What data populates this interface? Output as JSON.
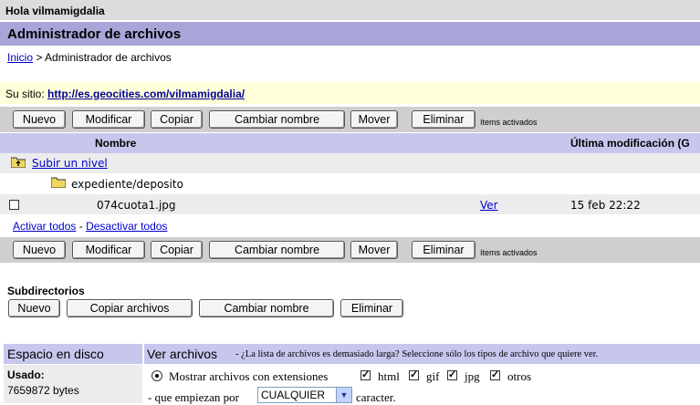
{
  "greeting": "Hola vilmamigdalia",
  "page_title": "Administrador de archivos",
  "breadcrumb": {
    "home": "Inicio",
    "sep": ">",
    "current": "Administrador de archivos"
  },
  "site": {
    "label": "Su sitio:",
    "url": "http://es.geocities.com/vilmamigdalia/"
  },
  "toolbar": {
    "buttons": [
      "Nuevo",
      "Modificar",
      "Copiar",
      "Cambiar nombre",
      "Mover",
      "Eliminar"
    ],
    "active_note": "ítems activados"
  },
  "table": {
    "col_name": "Nombre",
    "col_modified": "Última modificación (G",
    "up_level": "Subir un nivel",
    "folder": "expediente/deposito",
    "files": [
      {
        "name": "074cuota1.jpg",
        "view": "Ver",
        "modified": "15 feb 22:22",
        "checked": false
      }
    ]
  },
  "select_links": {
    "activate_all": "Activar todos",
    "dash": "-",
    "deactivate_all": "Desactivar todos"
  },
  "subdirs": {
    "title": "Subdirectorios",
    "buttons": [
      "Nuevo",
      "Copiar archivos",
      "Cambiar nombre",
      "Eliminar"
    ]
  },
  "disk": {
    "title": "Espacio en disco",
    "used_label": "Usado:",
    "used_value": "7659872 bytes"
  },
  "view_files": {
    "title": "Ver archivos",
    "hint": "- ¿La lista de archivos es demasiado larga? Seleccione sólo los tipos de archivo que quiere ver.",
    "show_ext_label": "Mostrar archivos con extensiones",
    "extensions": [
      {
        "label": "html",
        "checked": true
      },
      {
        "label": "gif",
        "checked": true
      },
      {
        "label": "jpg",
        "checked": true
      },
      {
        "label": "otros",
        "checked": true
      }
    ],
    "starts_with_label": "- que empiezan por",
    "starts_with_value": "CUALQUIER",
    "char_label": "caracter."
  }
}
